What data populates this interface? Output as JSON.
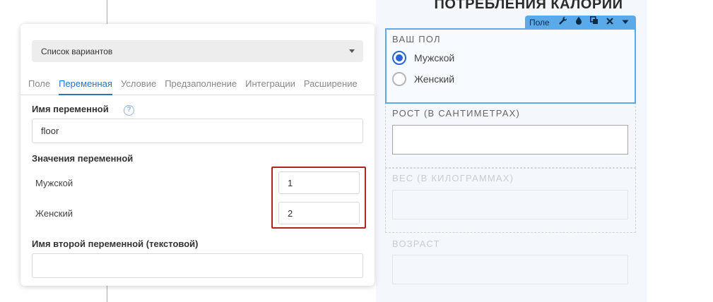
{
  "settings_panel": {
    "field_type_select": "Список вариантов",
    "tabs": [
      {
        "label": "Поле",
        "active": false
      },
      {
        "label": "Переменная",
        "active": true
      },
      {
        "label": "Условие",
        "active": false
      },
      {
        "label": "Предзаполнение",
        "active": false
      },
      {
        "label": "Интеграции",
        "active": false
      },
      {
        "label": "Расширение",
        "active": false
      }
    ],
    "variable_name_label": "Имя переменной",
    "variable_name_help": "?",
    "variable_name_value": "floor",
    "variable_values_label": "Значения переменной",
    "variable_values": [
      {
        "option": "Мужской",
        "value": "1"
      },
      {
        "option": "Женский",
        "value": "2"
      }
    ],
    "second_variable_label": "Имя второй переменной (текстовой)",
    "second_variable_value": "",
    "colors": {
      "accent": "#2574c9",
      "highlight": "#b0251e"
    }
  },
  "form_preview": {
    "title": "ПОТРЕБЛЕНИЯ КАЛОРИЙ",
    "toolbar": {
      "label": "Поле",
      "icons": [
        "wrench-icon",
        "drop-icon",
        "copy-icon",
        "close-icon",
        "caret-down-icon"
      ]
    },
    "gender_field": {
      "label": "ВАШ ПОЛ",
      "options": [
        {
          "label": "Мужской",
          "checked": true
        },
        {
          "label": "Женский",
          "checked": false
        }
      ]
    },
    "height_label": "РОСТ (В САНТИМЕТРАХ)",
    "weight_label": "ВЕС (В КИЛОГРАММАХ)",
    "age_label": "ВОЗРАСТ",
    "colors": {
      "selection": "#5aa9e8",
      "radio": "#2a63d6"
    }
  }
}
